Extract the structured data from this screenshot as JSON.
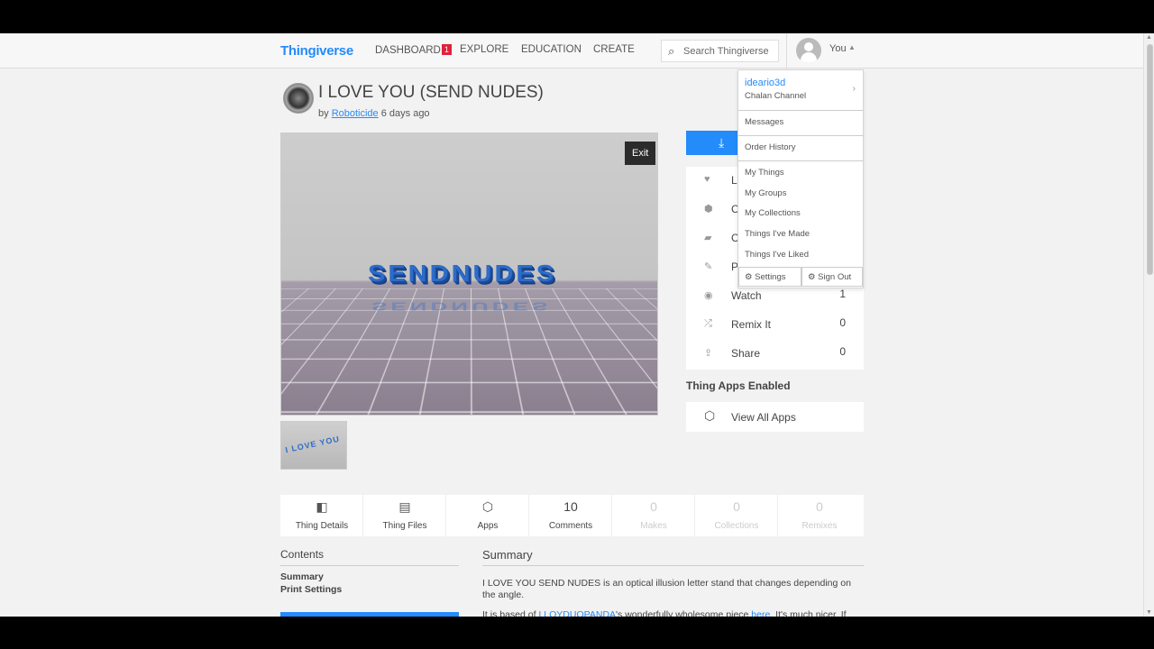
{
  "nav": {
    "logo": "Thingiverse",
    "links": {
      "dashboard": "DASHBOARD",
      "explore": "EXPLORE",
      "education": "EDUCATION",
      "create": "CREATE"
    },
    "dashboard_badge": "1",
    "search_placeholder": "Search Thingiverse",
    "you_label": "You"
  },
  "thing": {
    "title": "I LOVE YOU (SEND NUDES)",
    "by": "by",
    "author": "Roboticide",
    "posted": "6 days ago",
    "model_text": "SENDNUDES",
    "thumb_text": "I LOVE YOU"
  },
  "viewer": {
    "exit_label": "Exit"
  },
  "actions": {
    "like": {
      "label": "L",
      "icon": "heart-icon"
    },
    "collect": {
      "label": "C",
      "icon": "box-icon"
    },
    "comment": {
      "label": "C",
      "icon": "comment-icon"
    },
    "post": {
      "label": "P",
      "icon": "edit-icon"
    },
    "watch": {
      "label": "Watch",
      "count": "1",
      "icon": "eye-icon"
    },
    "remix": {
      "label": "Remix It",
      "count": "0",
      "icon": "shuffle-icon"
    },
    "share": {
      "label": "Share",
      "count": "0",
      "icon": "share-icon"
    }
  },
  "apps": {
    "heading": "Thing Apps Enabled",
    "view_all": "View All Apps"
  },
  "user_menu": {
    "username": "ideario3d",
    "channel": "Chalan Channel",
    "messages": "Messages",
    "order_history": "Order History",
    "my_things": "My Things",
    "my_groups": "My Groups",
    "my_collections": "My Collections",
    "things_made": "Things I've Made",
    "things_liked": "Things I've Liked",
    "settings": "Settings",
    "sign_out": "Sign Out"
  },
  "tabs": {
    "details": "Thing Details",
    "files": "Thing Files",
    "apps": "Apps",
    "comments_count": "10",
    "comments": "Comments",
    "makes_count": "0",
    "makes": "Makes",
    "collections_count": "0",
    "collections": "Collections",
    "remixes_count": "0",
    "remixes": "Remixes"
  },
  "contents": {
    "heading": "Contents",
    "items": [
      "Summary",
      "Print Settings"
    ]
  },
  "summary": {
    "heading": "Summary",
    "text": "I LOVE YOU SEND NUDES is an optical illusion letter stand that changes depending on the angle.",
    "cut_prefix": "It is based of ",
    "cut_link1": "LLOYDUOPANDA",
    "cut_mid": "'s wonderfully wholesome piece ",
    "cut_link2": "here",
    "cut_suffix": ". It's much nicer. If you're"
  },
  "colors": {
    "accent": "#248bfb",
    "badge": "#e0213a"
  }
}
